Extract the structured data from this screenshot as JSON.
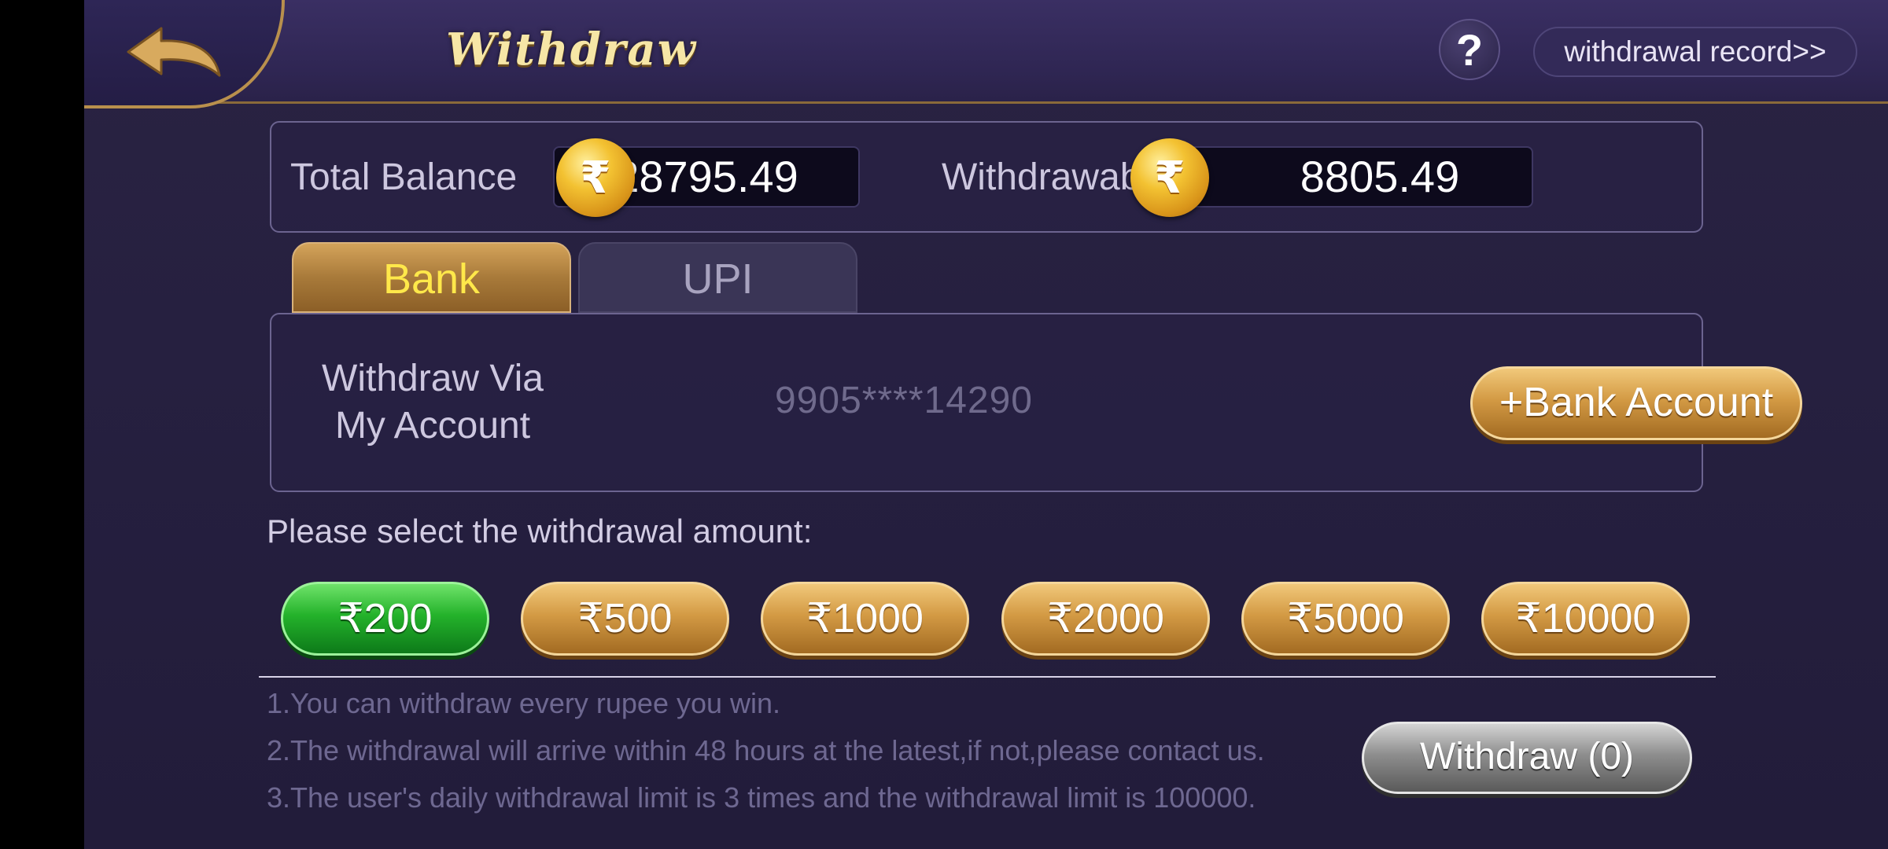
{
  "header": {
    "title": "Withdraw",
    "help_label": "?",
    "record_label": "withdrawal record>>"
  },
  "balance": {
    "total_label": "Total Balance",
    "total_value": "28795.49",
    "withdrawable_label": "Withdrawable",
    "withdrawable_value": "8805.49",
    "coin_symbol": "₹"
  },
  "tabs": [
    {
      "label": "Bank",
      "active": true
    },
    {
      "label": "UPI",
      "active": false
    }
  ],
  "account": {
    "via_line1": "Withdraw Via",
    "via_line2": "My Account",
    "number": "9905****14290",
    "add_button": "+Bank Account"
  },
  "amount": {
    "prompt": "Please select the withdrawal amount:",
    "options": [
      "₹200",
      "₹500",
      "₹1000",
      "₹2000",
      "₹5000",
      "₹10000"
    ],
    "selected_index": 0
  },
  "notes": [
    "1.You can withdraw every rupee you win.",
    "2.The withdrawal will arrive within 48 hours at the latest,if not,please contact us.",
    "3.The user's daily withdrawal limit is 3 times and the withdrawal limit is 100000."
  ],
  "withdraw_button": "Withdraw (0)",
  "colors": {
    "accent_gold": "#d39a44",
    "selected_green": "#24b22b",
    "tab_active_text": "#ffe84a",
    "background": "#262040"
  }
}
